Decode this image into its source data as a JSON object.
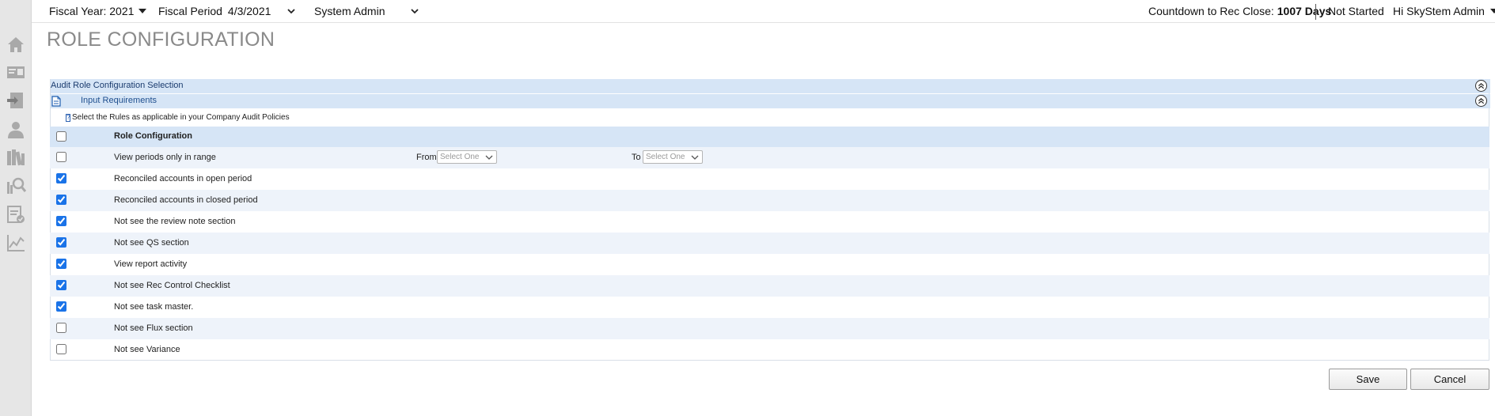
{
  "topbar": {
    "fiscal_year": "Fiscal Year: 2021",
    "fiscal_period_label": "Fiscal Period",
    "fiscal_period_value": "4/3/2021",
    "role": "System Admin",
    "countdown_label": "Countdown to Rec Close:",
    "countdown_value": "1007 Days",
    "status": "Not Started",
    "user_greeting": "Hi SkyStem Admin"
  },
  "page": {
    "title": "ROLE CONFIGURATION"
  },
  "panel": {
    "section_title": "Audit Role Configuration Selection",
    "subsection_title": "Input Requirements",
    "instruction": "Select the Rules as applicable in your Company Audit Policies"
  },
  "table": {
    "header_label": "Role Configuration",
    "header_checked": false,
    "range_from_label": "From",
    "range_to_label": "To",
    "select_placeholder": "Select One",
    "rows": [
      {
        "label": "View periods only in range",
        "checked": false
      },
      {
        "label": "Reconciled accounts in open period",
        "checked": true
      },
      {
        "label": "Reconciled accounts in closed period",
        "checked": true
      },
      {
        "label": "Not see the review note section",
        "checked": true
      },
      {
        "label": "Not see QS section",
        "checked": true
      },
      {
        "label": "View report activity",
        "checked": true
      },
      {
        "label": "Not see Rec Control Checklist",
        "checked": true
      },
      {
        "label": "Not see task master.",
        "checked": true
      },
      {
        "label": "Not see Flux section",
        "checked": false
      },
      {
        "label": "Not see Variance",
        "checked": false
      }
    ]
  },
  "actions": {
    "save": "Save",
    "cancel": "Cancel"
  },
  "sidebar_icons": [
    "home-icon",
    "accounts-icon",
    "import-icon",
    "user-icon",
    "library-icon",
    "search-report-icon",
    "checklist-icon",
    "analytics-icon"
  ],
  "colors": {
    "header_row": "#d6e5f6",
    "alt_row": "#eef3fa",
    "title_gray": "#8a8a8a",
    "sidebar_bg": "#e6e6e6",
    "checkbox_blue": "#1a73e8"
  }
}
